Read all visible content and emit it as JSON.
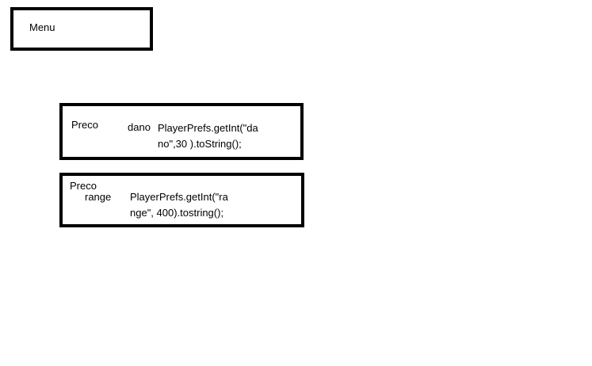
{
  "menu": {
    "label": "Menu"
  },
  "upgrades": [
    {
      "price_label": "Preco",
      "stat_name": "dano",
      "code_line_1": "PlayerPrefs.getInt(\"da",
      "code_line_2": "no\",30 ).toString();"
    },
    {
      "price_label": "Preco",
      "stat_name": "range",
      "code_line_1": "PlayerPrefs.getInt(\"ra",
      "code_line_2": "nge\", 400).tostring();"
    }
  ]
}
